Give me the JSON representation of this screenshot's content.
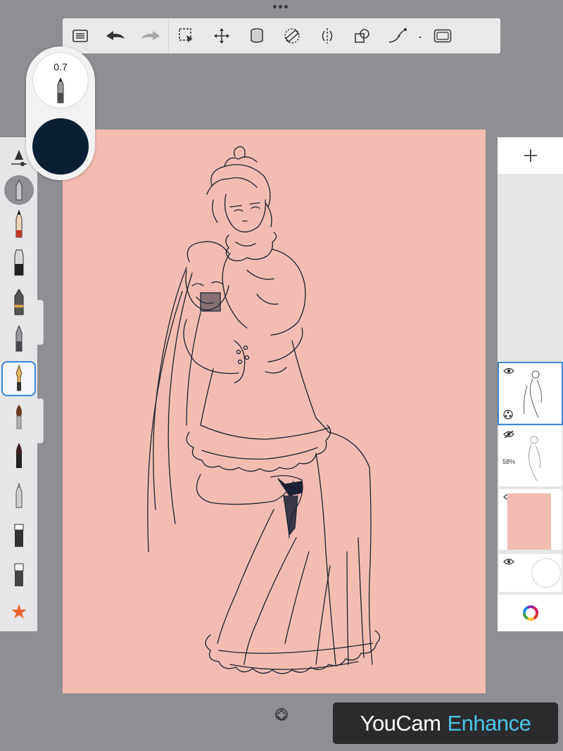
{
  "app": {
    "background_color": "#8e8e93",
    "panel_color": "#e6e6e8",
    "accent_color": "#3a86d8"
  },
  "top_toolbar": {
    "buttons": [
      {
        "name": "list-icon",
        "label": "Menu"
      },
      {
        "name": "undo-icon",
        "label": "Undo"
      },
      {
        "name": "redo-icon",
        "label": "Redo"
      },
      {
        "name": "selection-icon",
        "label": "Select"
      },
      {
        "name": "transform-icon",
        "label": "Transform"
      },
      {
        "name": "paint-bucket-icon",
        "label": "Fill"
      },
      {
        "name": "ruler-icon",
        "label": "Ruler"
      },
      {
        "name": "symmetry-icon",
        "label": "Symmetry"
      },
      {
        "name": "shapes-icon",
        "label": "Shapes"
      },
      {
        "name": "stroke-icon",
        "label": "Predictive stroke"
      },
      {
        "name": "fullscreen-icon",
        "label": "Canvas view"
      }
    ]
  },
  "brush_popover": {
    "size_value": "0.7",
    "current_color": "#0b1f33"
  },
  "brush_palette": {
    "selected_index": 4,
    "tools": [
      "pencil-icon",
      "marker-icon",
      "ink-pen-icon",
      "ballpoint-pen-icon",
      "fountain-pen-icon",
      "paintbrush-icon",
      "brush-pen-icon",
      "airbrush-icon",
      "smudge-icon",
      "eraser-icon",
      "favorites-star-icon"
    ]
  },
  "canvas": {
    "paper_color": "#f3bcb2",
    "ink_color": "#1a2233"
  },
  "layers_panel": {
    "layers": [
      {
        "name": "sketch-layer-active",
        "visible": true,
        "opacity_label": "",
        "active": true
      },
      {
        "name": "sketch-layer-faded",
        "visible": false,
        "opacity_label": "58%",
        "active": false
      },
      {
        "name": "paper-color-layer",
        "visible": true,
        "opacity_label": "",
        "active": false,
        "color": "#f3bcb2"
      },
      {
        "name": "background-layer",
        "visible": true,
        "opacity_label": "",
        "active": false
      }
    ]
  },
  "watermark": {
    "part1": "YouCam",
    "part2": "Enhance"
  }
}
